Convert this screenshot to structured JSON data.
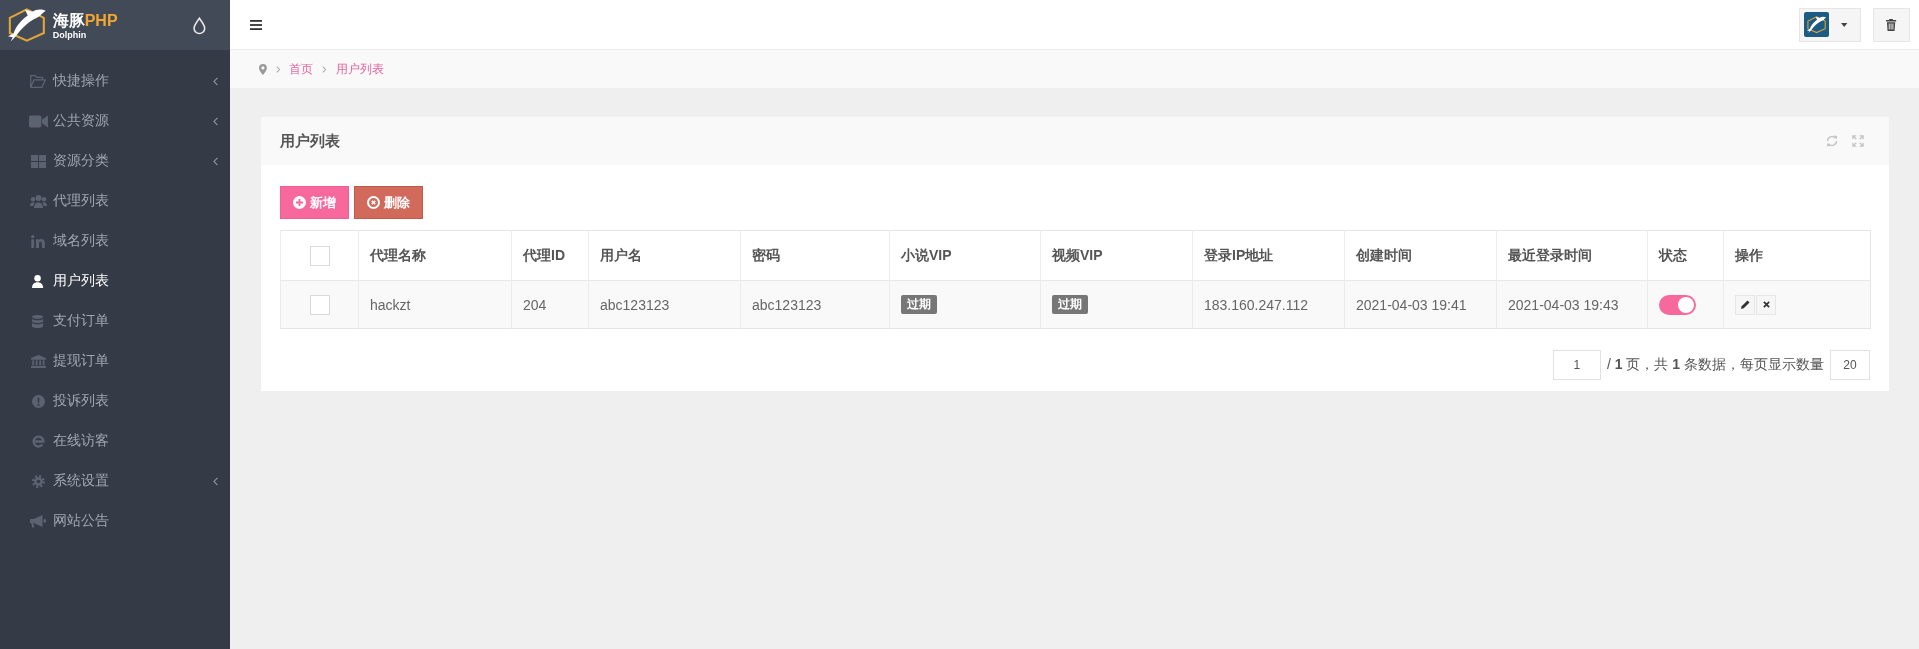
{
  "brand": {
    "name": "海豚",
    "name_accent": "PHP",
    "subtitle": "Dolphin"
  },
  "sidebar": {
    "items": [
      {
        "label": "快捷操作",
        "submenu": true,
        "selected": false
      },
      {
        "label": "公共资源",
        "submenu": true,
        "selected": false
      },
      {
        "label": "资源分类",
        "submenu": true,
        "selected": false
      },
      {
        "label": "代理列表",
        "submenu": false,
        "selected": false
      },
      {
        "label": "域名列表",
        "submenu": false,
        "selected": false
      },
      {
        "label": "用户列表",
        "submenu": false,
        "selected": true
      },
      {
        "label": "支付订单",
        "submenu": false,
        "selected": false
      },
      {
        "label": "提现订单",
        "submenu": false,
        "selected": false
      },
      {
        "label": "投诉列表",
        "submenu": false,
        "selected": false
      },
      {
        "label": "在线访客",
        "submenu": false,
        "selected": false
      },
      {
        "label": "系统设置",
        "submenu": true,
        "selected": false
      },
      {
        "label": "网站公告",
        "submenu": false,
        "selected": false
      }
    ]
  },
  "breadcrumb": [
    {
      "label": "首页"
    },
    {
      "label": "用户列表"
    }
  ],
  "card": {
    "title": "用户列表",
    "actions": [
      {
        "kind": "add",
        "label": "新增"
      },
      {
        "kind": "delete",
        "label": "删除"
      }
    ],
    "table": {
      "select_all": {
        "checked": false
      },
      "columns": [
        "代理名称",
        "代理ID",
        "用户名",
        "密码",
        "小说VIP",
        "视频VIP",
        "登录IP地址",
        "创建时间",
        "最近登录时间",
        "状态",
        "操作"
      ],
      "rows": [
        {
          "selected": false,
          "cells": [
            {
              "kind": "text",
              "text": "hackzt"
            },
            {
              "kind": "text",
              "text": "204"
            },
            {
              "kind": "text",
              "text": "abc123123"
            },
            {
              "kind": "text",
              "text": "abc123123"
            },
            {
              "kind": "badge",
              "text": "过期"
            },
            {
              "kind": "badge",
              "text": "过期"
            },
            {
              "kind": "text",
              "text": "183.160.247.112"
            },
            {
              "kind": "text",
              "text": "2021-04-03 19:41"
            },
            {
              "kind": "text",
              "text": "2021-04-03 19:43"
            },
            {
              "kind": "toggle",
              "on": true
            },
            {
              "kind": "actions"
            }
          ]
        }
      ]
    },
    "pagination": {
      "page": "1",
      "summary": "/ **1** 页，共 **1** 条数据，每页显示数量",
      "page_size": "20"
    }
  }
}
